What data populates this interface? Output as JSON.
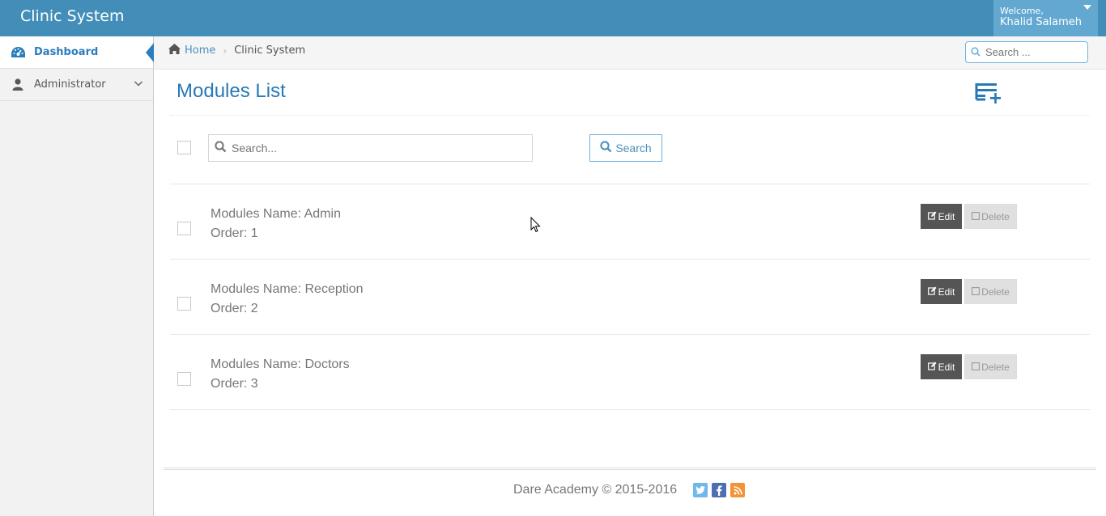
{
  "app": {
    "title": "Clinic System"
  },
  "user": {
    "welcome": "Welcome,",
    "name": "Khalid Salameh"
  },
  "sidebar": {
    "items": [
      {
        "label": "Dashboard",
        "icon": "dashboard-icon",
        "active": true
      },
      {
        "label": "Administrator",
        "icon": "user-icon",
        "active": false
      }
    ]
  },
  "breadcrumb": {
    "home": "Home",
    "current": "Clinic System"
  },
  "nav_search": {
    "placeholder": "Search ..."
  },
  "page": {
    "title": "Modules List"
  },
  "search": {
    "placeholder": "Search...",
    "button": "Search"
  },
  "modules": [
    {
      "name_line": "Modules Name: Admin",
      "order_line": "Order: 1"
    },
    {
      "name_line": "Modules Name: Reception",
      "order_line": "Order: 2"
    },
    {
      "name_line": "Modules Name: Doctors",
      "order_line": "Order: 3"
    }
  ],
  "actions": {
    "edit": "Edit",
    "delete": "Delete"
  },
  "footer": {
    "text": "Dare Academy © 2015-2016"
  },
  "colors": {
    "header": "#438eb9",
    "accent": "#2b7dbc",
    "twitter": "#70b7ec",
    "facebook": "#4f6eb0",
    "rss": "#f49336"
  }
}
